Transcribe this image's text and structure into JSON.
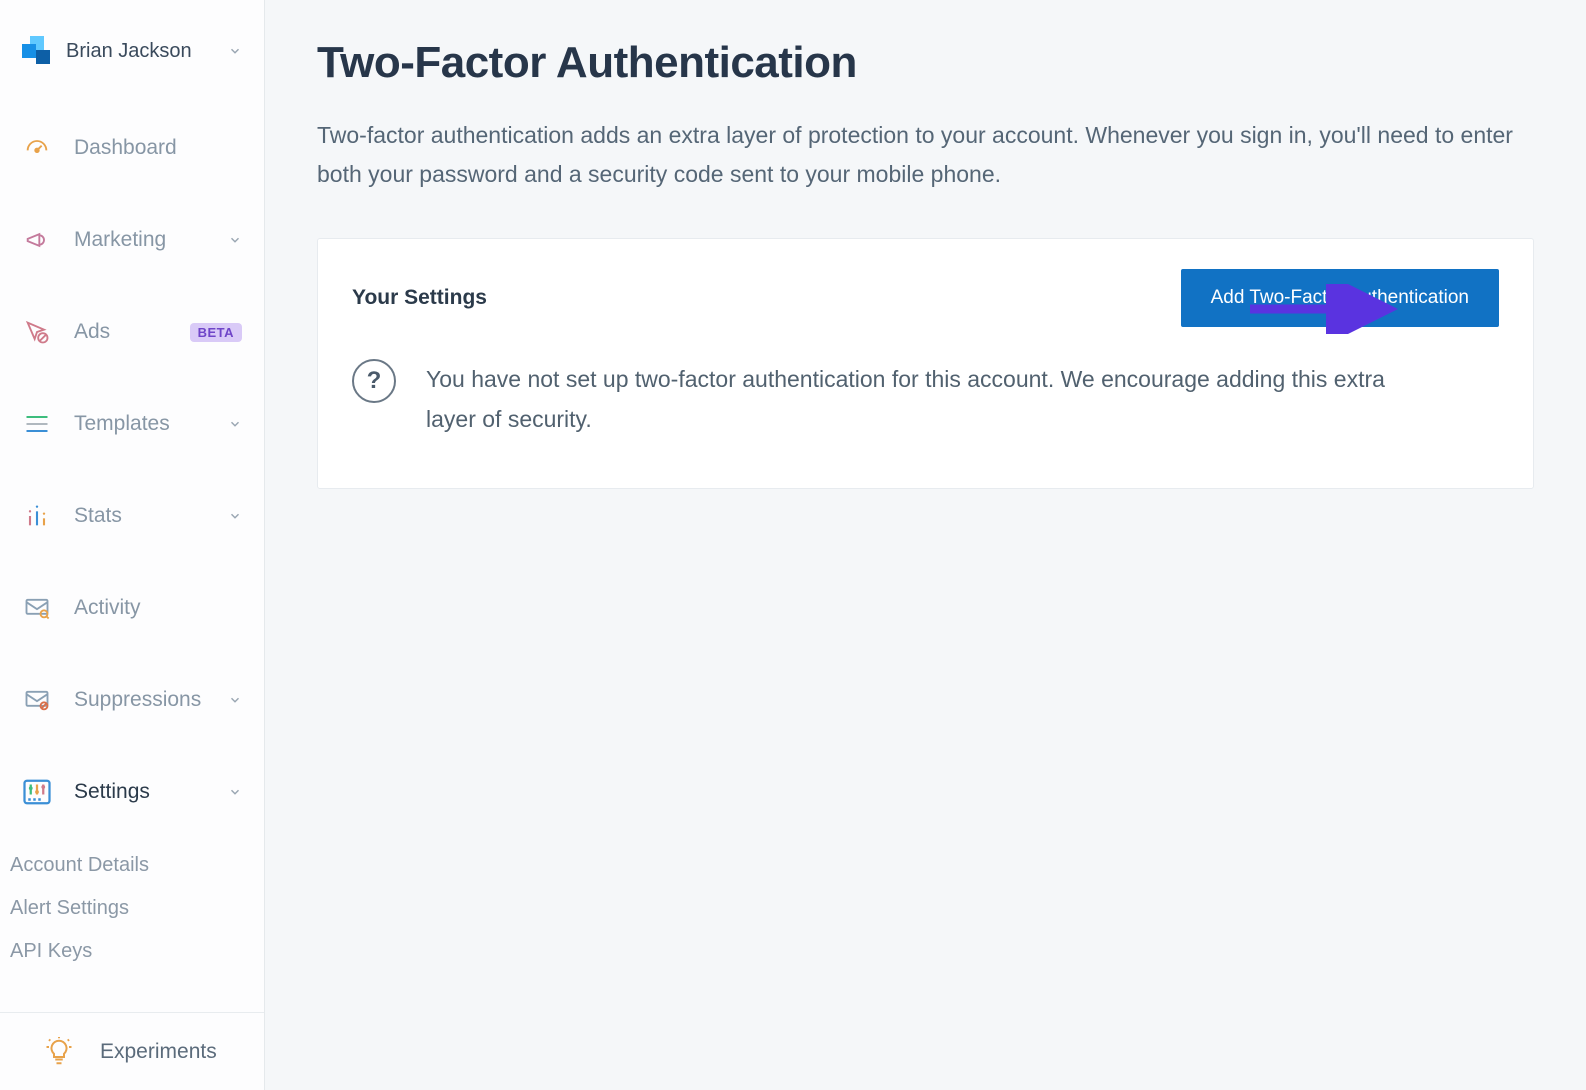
{
  "account": {
    "name": "Brian Jackson"
  },
  "sidebar": {
    "items": [
      {
        "label": "Dashboard"
      },
      {
        "label": "Marketing"
      },
      {
        "label": "Ads",
        "badge": "BETA"
      },
      {
        "label": "Templates"
      },
      {
        "label": "Stats"
      },
      {
        "label": "Activity"
      },
      {
        "label": "Suppressions"
      },
      {
        "label": "Settings"
      }
    ],
    "settings_sub": [
      {
        "label": "Account Details"
      },
      {
        "label": "Alert Settings"
      },
      {
        "label": "API Keys"
      }
    ],
    "footer": {
      "label": "Experiments"
    }
  },
  "page": {
    "title": "Two-Factor Authentication",
    "description": "Two-factor authentication adds an extra layer of protection to your account. Whenever you sign in, you'll need to enter both your password and a security code sent to your mobile phone."
  },
  "settings_card": {
    "title": "Your Settings",
    "add_button": "Add Two-Factor Authentication",
    "status_text": "You have not set up two-factor authentication for this account. We encourage adding this extra layer of security.",
    "status_icon": "?"
  },
  "colors": {
    "primary_button": "#1172c4",
    "annotation_arrow": "#5a33e0"
  }
}
